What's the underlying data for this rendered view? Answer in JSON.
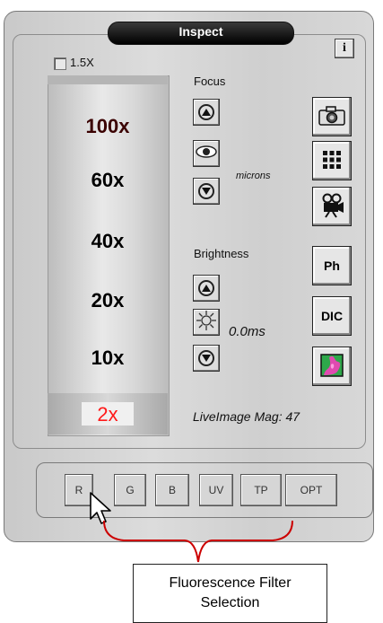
{
  "title": "Inspect",
  "info_label": "i",
  "checkbox": {
    "label": "1.5X",
    "checked": false
  },
  "magnifications": {
    "m100": "100x",
    "m60": "60x",
    "m40": "40x",
    "m20": "20x",
    "m10": "10x",
    "m2": "2x",
    "selected": "2x"
  },
  "focus": {
    "label": "Focus",
    "unit": "microns"
  },
  "brightness": {
    "label": "Brightness",
    "exposure": "0.0ms"
  },
  "side_buttons": {
    "ph": "Ph",
    "dic": "DIC"
  },
  "status": "LiveImage Mag: 47",
  "filters": [
    "R",
    "G",
    "B",
    "UV",
    "TP",
    "OPT"
  ],
  "callout": {
    "line1": "Fluorescence Filter",
    "line2": "Selection"
  },
  "colors": {
    "selected_mag": "#ff1a1a",
    "bracket": "#cc0000"
  }
}
